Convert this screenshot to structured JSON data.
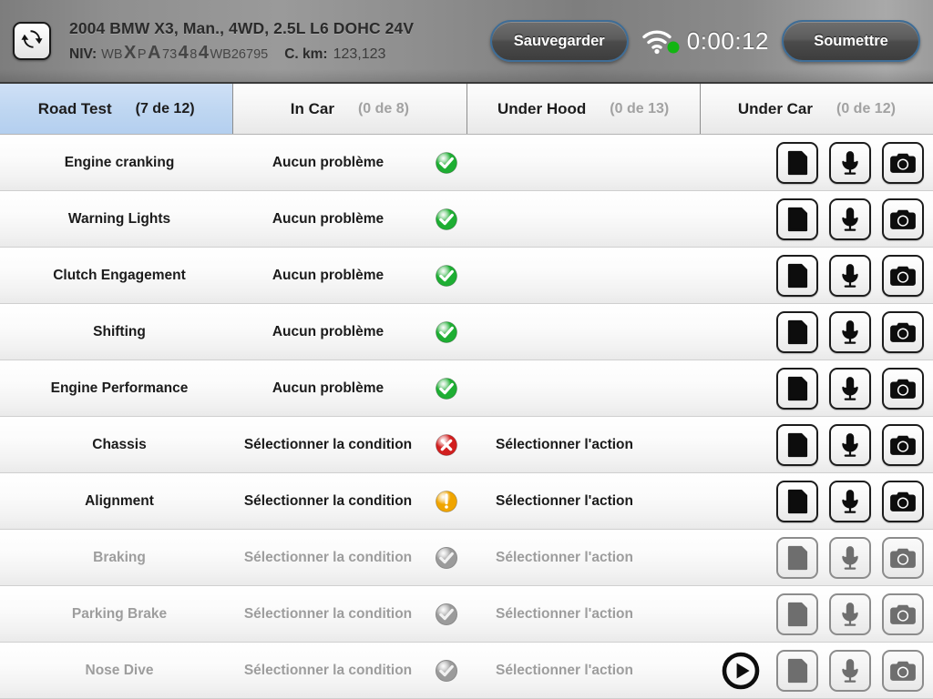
{
  "header": {
    "refresh_icon": "refresh-sync-icon",
    "vehicle_title": "2004 BMW X3, Man., 4WD, 2.5L L6 DOHC 24V",
    "vin_label": "NIV:",
    "vin_value": "WBXPA73484WB26795",
    "vin_chars": [
      {
        "c": "W",
        "big": false
      },
      {
        "c": "B",
        "big": false
      },
      {
        "c": "X",
        "big": true
      },
      {
        "c": "P",
        "big": false
      },
      {
        "c": "A",
        "big": true
      },
      {
        "c": "7",
        "big": false
      },
      {
        "c": "3",
        "big": false
      },
      {
        "c": "4",
        "big": true
      },
      {
        "c": "8",
        "big": false
      },
      {
        "c": "4",
        "big": true
      },
      {
        "c": "W",
        "big": false
      },
      {
        "c": "B",
        "big": false
      },
      {
        "c": "2",
        "big": false
      },
      {
        "c": "6",
        "big": false
      },
      {
        "c": "7",
        "big": false
      },
      {
        "c": "9",
        "big": false
      },
      {
        "c": "5",
        "big": false
      }
    ],
    "km_label": "C. km:",
    "km_value": "123,123",
    "save_label": "Sauvegarder",
    "submit_label": "Soumettre",
    "wifi_icon": "wifi-signal-icon",
    "connection_status_color": "#12b512",
    "timer": "0:00:12"
  },
  "tabs": [
    {
      "label": "Road Test",
      "count": "(7 de 12)",
      "active": true
    },
    {
      "label": "In Car",
      "count": "(0 de 8)",
      "active": false
    },
    {
      "label": "Under Hood",
      "count": "(0 de 13)",
      "active": false
    },
    {
      "label": "Under Car",
      "count": "(0 de 12)",
      "active": false
    }
  ],
  "icons": {
    "note": "note-document-icon",
    "mic": "microphone-icon",
    "camera": "camera-icon",
    "play": "play-button-icon"
  },
  "status_colors": {
    "ok": "#1eae33",
    "error": "#d21f1f",
    "warning": "#f0a500",
    "disabled": "#9b9b9b"
  },
  "rows": [
    {
      "name": "Engine cranking",
      "condition": "Aucun problème",
      "status": "ok",
      "action": "",
      "disabled": false,
      "play": false
    },
    {
      "name": "Warning Lights",
      "condition": "Aucun problème",
      "status": "ok",
      "action": "",
      "disabled": false,
      "play": false
    },
    {
      "name": "Clutch Engagement",
      "condition": "Aucun problème",
      "status": "ok",
      "action": "",
      "disabled": false,
      "play": false
    },
    {
      "name": "Shifting",
      "condition": "Aucun problème",
      "status": "ok",
      "action": "",
      "disabled": false,
      "play": false
    },
    {
      "name": "Engine Performance",
      "condition": "Aucun problème",
      "status": "ok",
      "action": "",
      "disabled": false,
      "play": false
    },
    {
      "name": "Chassis",
      "condition": "Sélectionner la condition",
      "status": "error",
      "action": "Sélectionner l'action",
      "disabled": false,
      "play": false
    },
    {
      "name": "Alignment",
      "condition": "Sélectionner la condition",
      "status": "warning",
      "action": "Sélectionner l'action",
      "disabled": false,
      "play": false
    },
    {
      "name": "Braking",
      "condition": "Sélectionner la condition",
      "status": "disabled",
      "action": "Sélectionner l'action",
      "disabled": true,
      "play": false
    },
    {
      "name": "Parking Brake",
      "condition": "Sélectionner la condition",
      "status": "disabled",
      "action": "Sélectionner l'action",
      "disabled": true,
      "play": false
    },
    {
      "name": "Nose Dive",
      "condition": "Sélectionner la condition",
      "status": "disabled",
      "action": "Sélectionner l'action",
      "disabled": true,
      "play": true
    }
  ]
}
